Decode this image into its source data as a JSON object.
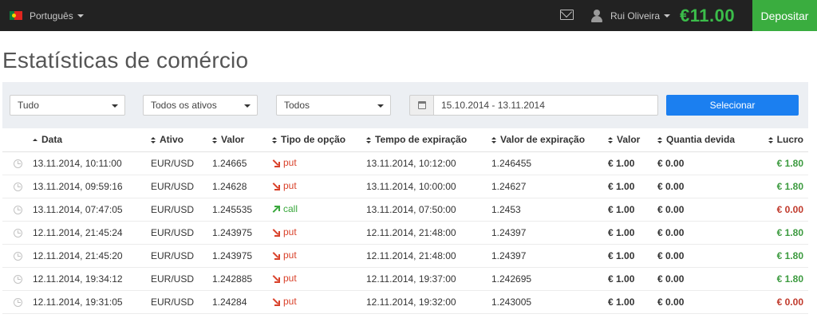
{
  "header": {
    "language": "Português",
    "user_name": "Rui Oliveira",
    "balance": "€11.00",
    "deposit_label": "Depositar"
  },
  "page_title": "Estatísticas de comércio",
  "filters": {
    "type_select": "Tudo",
    "asset_select": "Todos os ativos",
    "result_select": "Todos",
    "date_range": "15.10.2014 - 13.11.2014",
    "submit_label": "Selecionar"
  },
  "table": {
    "headers": {
      "date": "Data",
      "asset": "Ativo",
      "value": "Valor",
      "option_type": "Tipo de opção",
      "expiry_time": "Tempo de expiração",
      "expiry_value": "Valor de expiração",
      "amount": "Valor",
      "owed": "Quantia devida",
      "profit": "Lucro"
    },
    "rows": [
      {
        "date": "13.11.2014, 10:11:00",
        "asset": "EUR/USD",
        "value": "1.24665",
        "type": "put",
        "expiry_time": "13.11.2014, 10:12:00",
        "expiry_value": "1.246455",
        "amount": "€ 1.00",
        "owed": "€ 0.00",
        "profit": "€ 1.80"
      },
      {
        "date": "13.11.2014, 09:59:16",
        "asset": "EUR/USD",
        "value": "1.24628",
        "type": "put",
        "expiry_time": "13.11.2014, 10:00:00",
        "expiry_value": "1.24627",
        "amount": "€ 1.00",
        "owed": "€ 0.00",
        "profit": "€ 1.80"
      },
      {
        "date": "13.11.2014, 07:47:05",
        "asset": "EUR/USD",
        "value": "1.245535",
        "type": "call",
        "expiry_time": "13.11.2014, 07:50:00",
        "expiry_value": "1.2453",
        "amount": "€ 1.00",
        "owed": "€ 0.00",
        "profit": "€ 0.00"
      },
      {
        "date": "12.11.2014, 21:45:24",
        "asset": "EUR/USD",
        "value": "1.243975",
        "type": "put",
        "expiry_time": "12.11.2014, 21:48:00",
        "expiry_value": "1.24397",
        "amount": "€ 1.00",
        "owed": "€ 0.00",
        "profit": "€ 1.80"
      },
      {
        "date": "12.11.2014, 21:45:20",
        "asset": "EUR/USD",
        "value": "1.243975",
        "type": "put",
        "expiry_time": "12.11.2014, 21:48:00",
        "expiry_value": "1.24397",
        "amount": "€ 1.00",
        "owed": "€ 0.00",
        "profit": "€ 1.80"
      },
      {
        "date": "12.11.2014, 19:34:12",
        "asset": "EUR/USD",
        "value": "1.242885",
        "type": "put",
        "expiry_time": "12.11.2014, 19:37:00",
        "expiry_value": "1.242695",
        "amount": "€ 1.00",
        "owed": "€ 0.00",
        "profit": "€ 1.80"
      },
      {
        "date": "12.11.2014, 19:31:05",
        "asset": "EUR/USD",
        "value": "1.24284",
        "type": "put",
        "expiry_time": "12.11.2014, 19:32:00",
        "expiry_value": "1.243005",
        "amount": "€ 1.00",
        "owed": "€ 0.00",
        "profit": "€ 0.00"
      }
    ]
  },
  "colors": {
    "topbar": "#222222",
    "balance": "#3bbd4a",
    "deposit": "#3aad3f",
    "primary_button": "#1b7ff0",
    "put": "#d9412a",
    "call": "#3aa83d",
    "profit_positive": "#3b9a3e",
    "profit_zero": "#c0392b"
  }
}
